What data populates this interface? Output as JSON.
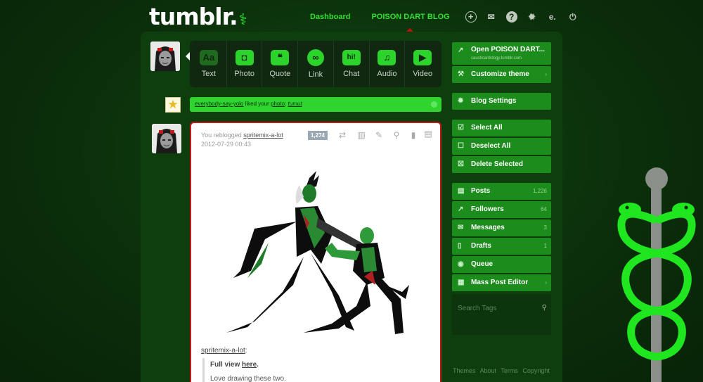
{
  "logo": {
    "text": "tumblr.",
    "mark": "⚕"
  },
  "topnav": {
    "dashboard": "Dashboard",
    "blog": "POISON DART BLOG",
    "icons": [
      "new-post-icon",
      "messages-icon",
      "help-icon",
      "settings-icon",
      "editor-icon",
      "logout-icon"
    ],
    "icon_glyphs": [
      "+",
      "✉",
      "?",
      "✹",
      "e.",
      "⏻"
    ]
  },
  "post_types": [
    {
      "label": "Text",
      "icon": "Aa"
    },
    {
      "label": "Photo",
      "icon": "◘"
    },
    {
      "label": "Quote",
      "icon": "❝"
    },
    {
      "label": "Link",
      "icon": "∞"
    },
    {
      "label": "Chat",
      "icon": "hi!"
    },
    {
      "label": "Audio",
      "icon": "♫"
    },
    {
      "label": "Video",
      "icon": "▶"
    }
  ],
  "notification": {
    "user": "everybody-say-yolo",
    "text": " liked your ",
    "link": "photo",
    "colon": ": ",
    "caption": "tumut"
  },
  "post": {
    "reblog_prefix": "You reblogged ",
    "reblog_user": "spritemix-a-lot",
    "date": "2012-07-29 00:43",
    "note_count": "1,274",
    "source_user": "spritemix-a-lot",
    "source_colon": ":",
    "quote_prefix": "Full view ",
    "quote_link": "here",
    "quote_suffix": ".",
    "quote_text": "Love drawing these two."
  },
  "sidebar": {
    "open_blog": {
      "label": "Open POISON DART...",
      "sub": "causticantidogy.tumblr.com"
    },
    "customize": {
      "label": "Customize theme"
    },
    "blog_settings": {
      "label": "Blog Settings"
    },
    "select_all": {
      "label": "Select All"
    },
    "deselect_all": {
      "label": "Deselect All"
    },
    "delete_selected": {
      "label": "Delete Selected"
    },
    "posts": {
      "label": "Posts",
      "count": "1,226"
    },
    "followers": {
      "label": "Followers",
      "count": "64"
    },
    "messages": {
      "label": "Messages",
      "count": "3"
    },
    "drafts": {
      "label": "Drafts",
      "count": "1"
    },
    "queue": {
      "label": "Queue"
    },
    "mass_editor": {
      "label": "Mass Post Editor"
    },
    "search_placeholder": "Search Tags"
  },
  "footer": [
    "Themes",
    "About",
    "Terms",
    "Copyright"
  ],
  "colors": {
    "accent": "#2fd42f",
    "panel": "#0e3d0e",
    "button": "#1c8d1c",
    "post_border": "#c41a1a"
  }
}
